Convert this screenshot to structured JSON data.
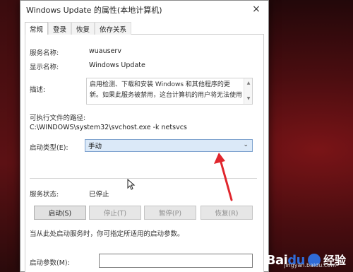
{
  "window": {
    "title": "Windows Update 的属性(本地计算机)",
    "close_glyph": "×"
  },
  "tabs": [
    {
      "label": "常规",
      "active": true
    },
    {
      "label": "登录",
      "active": false
    },
    {
      "label": "恢复",
      "active": false
    },
    {
      "label": "依存关系",
      "active": false
    }
  ],
  "general": {
    "service_name_label": "服务名称:",
    "service_name_value": "wuauserv",
    "display_name_label": "显示名称:",
    "display_name_value": "Windows Update",
    "description_label": "描述:",
    "description_value": "启用检测、下载和安装 Windows 和其他程序的更新。如果此服务被禁用，这台计算机的用户将无法使用",
    "exe_path_label": "可执行文件的路径:",
    "exe_path_value": "C:\\WINDOWS\\system32\\svchost.exe -k netsvcs",
    "startup_type_label": "启动类型(E):",
    "startup_type_value": "手动",
    "service_status_label": "服务状态:",
    "service_status_value": "已停止",
    "buttons": {
      "start": "启动(S)",
      "stop": "停止(T)",
      "pause": "暂停(P)",
      "resume": "恢复(R)"
    },
    "hint_text": "当从此处启动服务时，你可指定所适用的启动参数。",
    "start_params_label": "启动参数(M):",
    "start_params_value": ""
  },
  "watermark": {
    "brand_a": "Bai",
    "brand_b": "du",
    "brand_cn": "经验",
    "url": "jingyan.baidu.com"
  },
  "colors": {
    "annotation_arrow": "#e0262d",
    "select_bg": "#dbe9f8"
  }
}
